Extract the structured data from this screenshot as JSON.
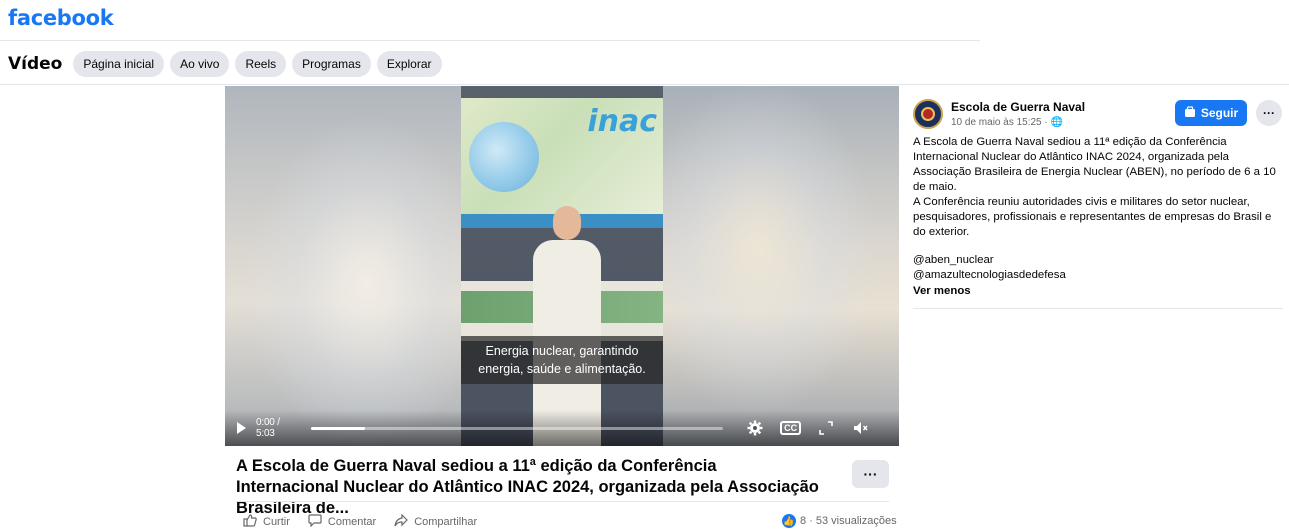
{
  "header": {
    "logo": "facebook"
  },
  "video_nav": {
    "title": "Vídeo",
    "tabs": [
      "Página inicial",
      "Ao vivo",
      "Reels",
      "Programas",
      "Explorar"
    ]
  },
  "player": {
    "subtitle_line1": "Energia nuclear, garantindo",
    "subtitle_line2": "energia, saúde e alimentação.",
    "time": "0:00 / 5:03",
    "progress_fraction": 0.13,
    "cc_label": "CC"
  },
  "video": {
    "title": "A Escola de Guerra Naval sediou a 11ª edição da Conferência Internacional Nuclear do Atlântico INAC 2024, organizada pela Associação Brasileira de...",
    "more_label": "···",
    "actions": {
      "like": "Curtir",
      "comment": "Comentar",
      "share": "Compartilhar"
    },
    "stats": "8 · 53 visualizações"
  },
  "post": {
    "author": "Escola de Guerra Naval",
    "meta": "10 de maio às 15:25 · 🌐",
    "follow_label": "Seguir",
    "more_label": "···",
    "paragraph1": "A Escola de Guerra Naval sediou a 11ª edição da Conferência Internacional Nuclear do Atlântico INAC 2024, organizada pela Associação Brasileira de Energia Nuclear (ABEN), no período de 6 a 10 de maio.",
    "paragraph2": "A Conferência reuniu autoridades civis e militares do setor nuclear, pesquisadores, profissionais e representantes de empresas do Brasil e do exterior.",
    "tag1": "@aben_nuclear",
    "tag2": "@amazultecnologiasdedefesa",
    "see_less": "Ver menos"
  }
}
